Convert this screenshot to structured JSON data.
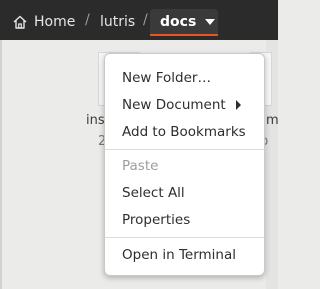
{
  "pathbar": {
    "home_label": "Home",
    "lutris_label": "lutris",
    "docs_label": "docs",
    "separator": "/",
    "accent_color": "#e95420"
  },
  "files": [
    {
      "name_partial": "inst",
      "size_partial": "2"
    },
    {
      "name_partial": "am",
      "size_partial": "b"
    }
  ],
  "context_menu": {
    "items": [
      {
        "label": "New Folder…",
        "enabled": true
      },
      {
        "label": "New Document",
        "enabled": true,
        "submenu": true
      },
      {
        "label": "Add to Bookmarks",
        "enabled": true
      },
      {
        "label": "Paste",
        "enabled": false
      },
      {
        "label": "Select All",
        "enabled": true
      },
      {
        "label": "Properties",
        "enabled": true
      },
      {
        "label": "Open in Terminal",
        "enabled": true
      }
    ]
  }
}
